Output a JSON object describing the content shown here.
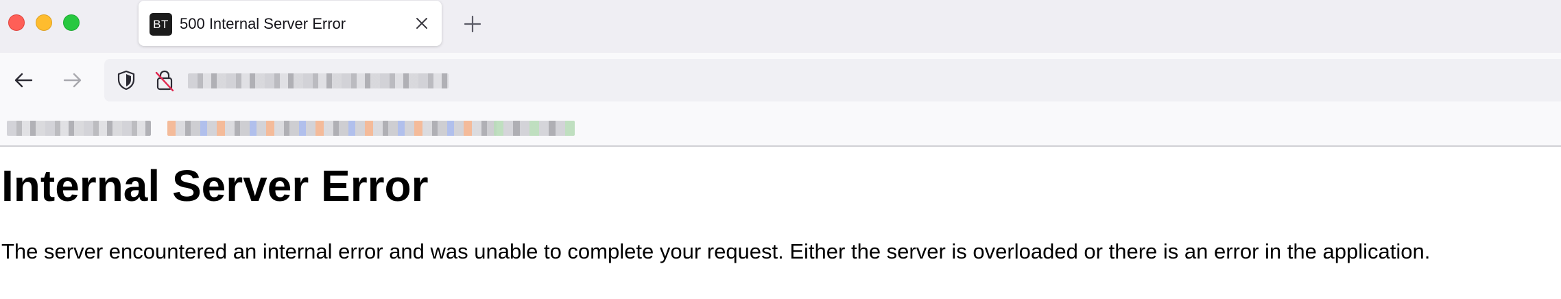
{
  "window": {
    "controls": [
      "close",
      "minimize",
      "maximize"
    ]
  },
  "tab": {
    "favicon_text": "BT",
    "title": "500 Internal Server Error",
    "close_icon": "close-icon"
  },
  "new_tab_icon": "plus-icon",
  "nav": {
    "back_icon": "arrow-left-icon",
    "forward_icon": "arrow-right-icon",
    "shield_icon": "shield-icon",
    "lock_icon": "lock-insecure-icon",
    "url": ""
  },
  "bookmarks": [
    {
      "label": ""
    },
    {
      "label": ""
    },
    {
      "label": ""
    }
  ],
  "page": {
    "heading": "Internal Server Error",
    "message": "The server encountered an internal error and was unable to complete your request. Either the server is overloaded or there is an error in the application."
  },
  "colors": {
    "tabstrip_bg": "#efeef3",
    "toolbar_bg": "#f9f9fb",
    "urlbar_bg": "#f0f0f4",
    "close_red": "#fe5f57",
    "minimize_yellow": "#febc2e",
    "maximize_green": "#28c840"
  }
}
